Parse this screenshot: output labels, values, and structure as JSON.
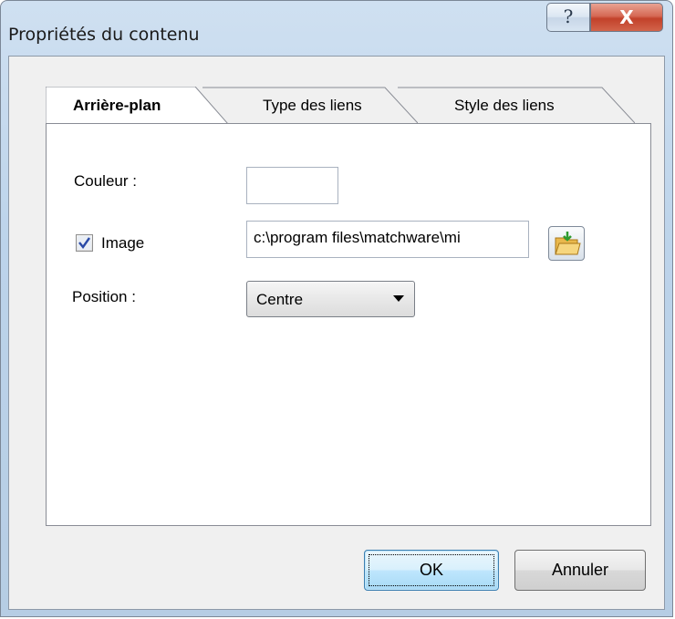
{
  "window": {
    "title": "Propriétés du contenu",
    "help_label": "?",
    "close_label": "X"
  },
  "tabs": [
    {
      "label": "Arrière-plan",
      "active": true
    },
    {
      "label": "Type des liens",
      "active": false
    },
    {
      "label": "Style des liens",
      "active": false
    }
  ],
  "form": {
    "color_label": "Couleur :",
    "image_label": "Image",
    "image_checked": true,
    "image_path": "c:\\program files\\matchware\\mi",
    "position_label": "Position :",
    "position_value": "Centre"
  },
  "buttons": {
    "ok": "OK",
    "cancel": "Annuler"
  },
  "icons": {
    "folder_browse": "folder-open-icon",
    "dropdown": "chevron-down-icon",
    "check": "check-icon"
  }
}
